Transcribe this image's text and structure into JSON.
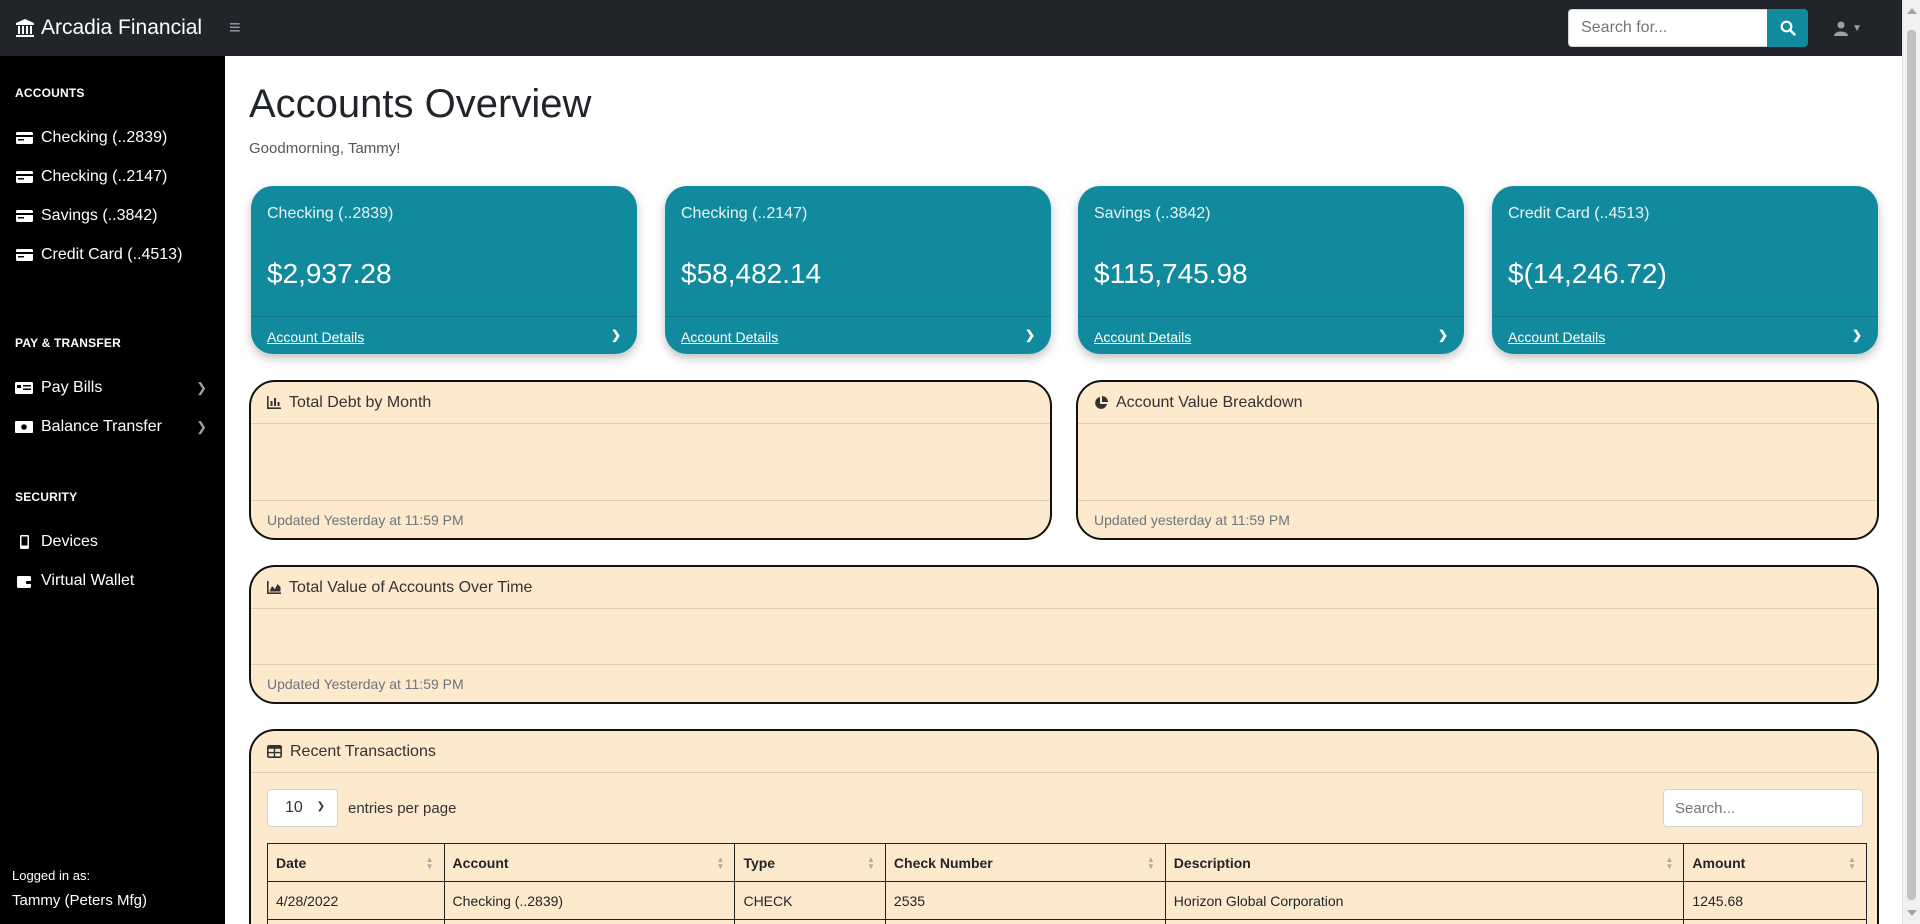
{
  "app": {
    "brand": "Arcadia Financial"
  },
  "topbar": {
    "search_placeholder": "Search for..."
  },
  "sidebar": {
    "sections": [
      {
        "heading": "ACCOUNTS"
      },
      {
        "heading": "PAY & TRANSFER"
      },
      {
        "heading": "SECURITY"
      }
    ],
    "accounts": [
      "Checking (..2839)",
      "Checking (..2147)",
      "Savings (..3842)",
      "Credit Card (..4513)"
    ],
    "pay_transfer": [
      "Pay Bills",
      "Balance Transfer"
    ],
    "security": [
      "Devices",
      "Virtual Wallet"
    ],
    "logged_in_label": "Logged in as:",
    "logged_in_user": "Tammy (Peters Mfg)"
  },
  "main": {
    "title": "Accounts Overview",
    "greeting": "Goodmorning, Tammy!"
  },
  "cards": [
    {
      "name": "Checking (..2839)",
      "balance": "$2,937.28",
      "link": "Account Details"
    },
    {
      "name": "Checking (..2147)",
      "balance": "$58,482.14",
      "link": "Account Details"
    },
    {
      "name": "Savings (..3842)",
      "balance": "$115,745.98",
      "link": "Account Details"
    },
    {
      "name": "Credit Card (..4513)",
      "balance": "$(14,246.72)",
      "link": "Account Details"
    }
  ],
  "panels": {
    "debt": {
      "title": "Total Debt by Month",
      "updated": "Updated Yesterday at 11:59 PM"
    },
    "breakdown": {
      "title": "Account Value Breakdown",
      "updated": "Updated yesterday at 11:59 PM"
    },
    "over_time": {
      "title": "Total Value of Accounts Over Time",
      "updated": "Updated Yesterday at 11:59 PM"
    },
    "transactions": {
      "title": "Recent Transactions",
      "entries_value": "10",
      "entries_label": "entries per page",
      "search_placeholder": "Search...",
      "columns": [
        "Date",
        "Account",
        "Type",
        "Check Number",
        "Description",
        "Amount"
      ],
      "rows": [
        [
          "4/28/2022",
          "Checking (..2839)",
          "CHECK",
          "2535",
          "Horizon Global Corporation",
          "1245.68"
        ]
      ]
    }
  },
  "colors": {
    "accent": "#128a9e",
    "panel_bg": "#fde9cc",
    "topbar": "#212529",
    "sidebar": "#000000"
  }
}
